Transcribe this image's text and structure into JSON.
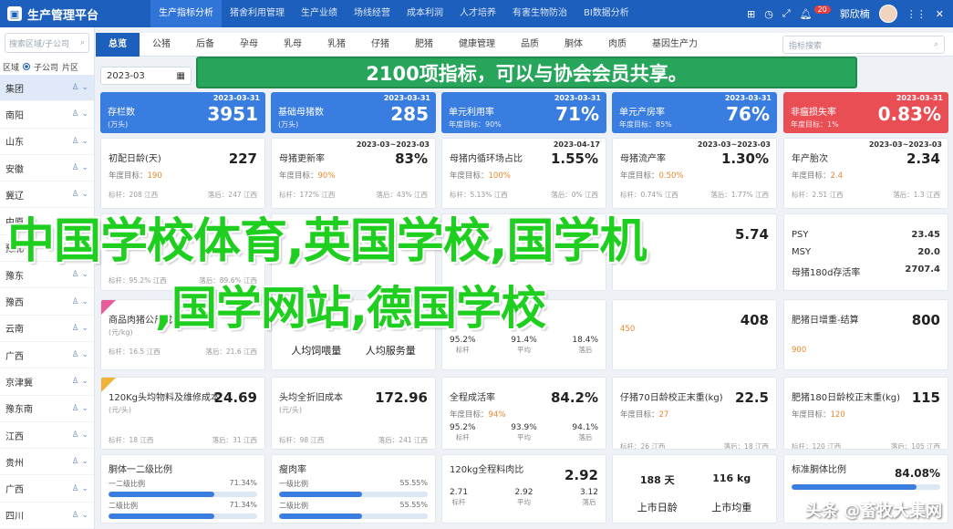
{
  "app": {
    "title": "生产管理平台",
    "user": "郭欣楠",
    "notif_count": "20"
  },
  "topnav": [
    "生产指标分析",
    "猪舍利用管理",
    "生产业绩",
    "场线经营",
    "成本利润",
    "人才培养",
    "有害生物防治",
    "BI数据分析"
  ],
  "sidebar": {
    "search_placeholder": "搜索区域/子公司",
    "radio_a": "区域",
    "radio_b": "子公司",
    "radio_c": "片区",
    "regions": [
      "集团",
      "南阳",
      "山东",
      "安徽",
      "冀辽",
      "中原",
      "豫北",
      "豫东",
      "豫西",
      "云南",
      "广西",
      "京津冀",
      "豫东南",
      "江西",
      "贵州",
      "广西",
      "四川"
    ]
  },
  "tabs": [
    "总览",
    "公猪",
    "后备",
    "孕母",
    "乳母",
    "乳猪",
    "仔猪",
    "肥猪",
    "健康管理",
    "品质",
    "胴体",
    "肉质",
    "基因生产力"
  ],
  "tab_search_placeholder": "指标搜索",
  "date": "2023-03",
  "banner": "2100项指标，可以与协会会员共享。",
  "kpis": [
    {
      "title": "存栏数",
      "sub": "(万头)",
      "value": "3951",
      "date": "2023-03-31",
      "color": "#3a7de0"
    },
    {
      "title": "基础母猪数",
      "sub": "(万头)",
      "value": "285",
      "date": "2023-03-31",
      "color": "#3a7de0"
    },
    {
      "title": "单元利用率",
      "sub": "年度目标：90%",
      "value": "71%",
      "date": "2023-03-31",
      "color": "#3a7de0"
    },
    {
      "title": "单元产房率",
      "sub": "年度目标：85%",
      "value": "76%",
      "date": "2023-03-31",
      "color": "#3a7de0"
    },
    {
      "title": "非瘟损失率",
      "sub": "年度目标：1%",
      "value": "0.83%",
      "date": "2023-03-31",
      "color": "#ea4e55"
    }
  ],
  "row2": [
    {
      "title": "初配日龄(天)",
      "target_label": "年度目标：",
      "target": "190",
      "value": "227",
      "date": "",
      "foot_a": "标杆：208 江西",
      "foot_b": "落后：247 江西"
    },
    {
      "title": "母猪更新率",
      "target_label": "年度目标：",
      "target": "90%",
      "value": "83%",
      "date": "2023-03~2023-03",
      "foot_a": "标杆：172% 江西",
      "foot_b": "落后：43% 江西"
    },
    {
      "title": "母猪内循环场占比",
      "target_label": "年度目标：",
      "target": "100%",
      "value": "1.55%",
      "date": "2023-04-17",
      "foot_a": "标杆：5.13% 江西",
      "foot_b": "落后：0% 江西"
    },
    {
      "title": "母猪流产率",
      "target_label": "年度目标：",
      "target": "0.50%",
      "value": "1.30%",
      "date": "2023-03~2023-03",
      "foot_a": "标杆：0.74% 江西",
      "foot_b": "落后：1.77% 江西"
    },
    {
      "title": "年产胎次",
      "target_label": "年度目标：",
      "target": "2.4",
      "value": "2.34",
      "date": "2023-03~2023-03",
      "foot_a": "标杆：2.51 江西",
      "foot_b": "落后：1.3 江西"
    }
  ],
  "row3": [
    {
      "title": "",
      "value": "",
      "foot_a": "标杆：95.2% 江西",
      "foot_b": "落后：89.6% 江西"
    },
    {
      "title": "",
      "value": "",
      "foot_a": "",
      "foot_b": ""
    },
    {
      "title": "",
      "value": "",
      "foot_a": "",
      "foot_b": ""
    },
    {
      "title": "",
      "value": "5.74",
      "foot_a": "",
      "foot_b": ""
    },
    {
      "title": "",
      "value": "",
      "rows": [
        {
          "k": "PSY",
          "v": "23.45"
        },
        {
          "k": "MSY",
          "v": "20.0"
        },
        {
          "k": "母猪180d存活率",
          "v": "2707.4"
        }
      ]
    }
  ],
  "row4": [
    {
      "title": "商品肉猪公斤成本",
      "sub": "(元/kg)",
      "value": "",
      "foot_a": "标杆：16.5 江西",
      "foot_b": "落后：21.6 江西"
    },
    {
      "title": "",
      "sub": "",
      "value": "",
      "bottom": [
        "人均饲喂量",
        "人均服务量"
      ]
    },
    {
      "title": "",
      "value": "",
      "trio": [
        {
          "v": "95.2%",
          "l": "标杆"
        },
        {
          "v": "91.4%",
          "l": "平均"
        },
        {
          "v": "18.4%",
          "l": "落后"
        }
      ]
    },
    {
      "title": "",
      "value": "408",
      "target": "450"
    },
    {
      "title": "肥猪日增重-结算",
      "value": "800",
      "target": "900"
    }
  ],
  "row5": [
    {
      "title": "120Kg头均物料及维修成本",
      "sub": "(元/头)",
      "value": "24.69",
      "foot_a": "标杆：18 江西",
      "foot_b": "落后：31 江西"
    },
    {
      "title": "头均全折旧成本",
      "sub": "(元/头)",
      "value": "172.96",
      "foot_a": "标杆：98 江西",
      "foot_b": "落后：241 江西"
    },
    {
      "title": "全程成活率",
      "target_label": "年度目标：",
      "target": "94%",
      "value": "84.2%",
      "trio": [
        {
          "v": "95.2%",
          "l": "标杆"
        },
        {
          "v": "93.9%",
          "l": "平均"
        },
        {
          "v": "94.1%",
          "l": "落后"
        }
      ]
    },
    {
      "title": "仔猪70日龄校正末重(kg)",
      "target_label": "年度目标：",
      "target": "27",
      "value": "22.5",
      "foot_a": "标杆：26 江西",
      "foot_b": "落后：18 江西"
    },
    {
      "title": "肥猪180日龄校正末重(kg)",
      "target_label": "年度目标：",
      "target": "120",
      "value": "115",
      "foot_a": "标杆：120 江西",
      "foot_b": "落后：105 江西"
    }
  ],
  "row6": [
    {
      "title": "胴体一二级比例",
      "l1": "一二级比例",
      "v1": "71.34%",
      "p1": 0.71,
      "l2": "二级比例",
      "v2": "71.34%",
      "p2": 0.71
    },
    {
      "title": "瘦肉率",
      "l1": "一级比例",
      "v1": "55.55%",
      "p1": 0.56,
      "l2": "二级比例",
      "v2": "55.55%",
      "p2": 0.56
    },
    {
      "title": "120kg全程料肉比",
      "value": "2.92",
      "trio": [
        {
          "v": "2.71",
          "l": "标杆"
        },
        {
          "v": "2.92",
          "l": "平均"
        },
        {
          "v": "3.12",
          "l": "落后"
        }
      ]
    },
    {
      "title": "",
      "a": "188 天",
      "b": "116 kg",
      "c": "上市日龄",
      "d": "上市均重"
    },
    {
      "title": "标准胴体比例",
      "value": "84.08%",
      "p": 0.84
    }
  ],
  "overlay": {
    "line1": "中国学校体育,英国学校,国学机",
    "line2": ",国学网站,德国学校"
  },
  "watermark": "头条 @畜牧大集网"
}
